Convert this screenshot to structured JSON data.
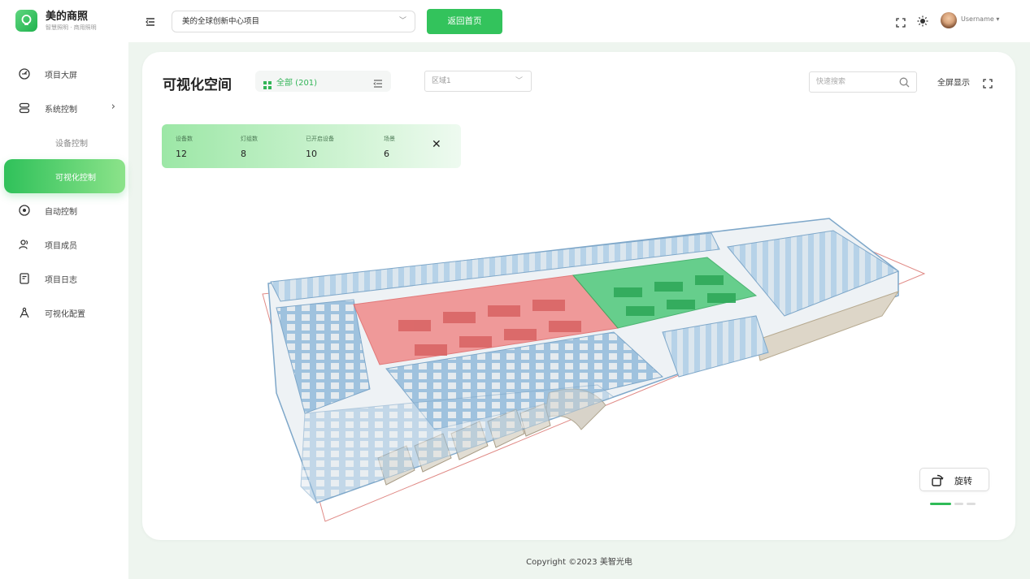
{
  "app": {
    "brand_name": "美的商照",
    "brand_sub": "智慧照明 · 商用照明"
  },
  "sidebar": {
    "items": [
      {
        "label": "项目大屏",
        "icon": "dashboard-icon"
      },
      {
        "label": "系统控制",
        "icon": "layers-icon",
        "expandable": true
      },
      {
        "label": "设备控制",
        "sub": true
      },
      {
        "label": "可视化控制",
        "sub": true,
        "active": true
      },
      {
        "label": "自动控制",
        "icon": "target-icon"
      },
      {
        "label": "项目成员",
        "icon": "users-icon"
      },
      {
        "label": "项目日志",
        "icon": "log-icon"
      },
      {
        "label": "可视化配置",
        "icon": "compass-icon"
      }
    ]
  },
  "topbar": {
    "project": "美的全球创新中心项目",
    "home_button": "返回首页",
    "username": "Username"
  },
  "main": {
    "title": "可视化空间",
    "filter_label": "全部 (201)",
    "region_placeholder": "区域1",
    "search_placeholder": "快速搜索",
    "fullscreen_label": "全屏显示",
    "rotate_label": "旋转"
  },
  "stats": [
    {
      "label": "设备数",
      "value": "12"
    },
    {
      "label": "灯组数",
      "value": "8"
    },
    {
      "label": "已开启设备",
      "value": "10"
    },
    {
      "label": "场景",
      "value": "6"
    }
  ],
  "pagination": {
    "total": 3,
    "active": 1
  },
  "footer": {
    "copyright": "Copyright ©2023 美智光电"
  },
  "colors": {
    "accent": "#33c35c",
    "zone_red": "#f08a8a",
    "zone_green": "#4fc87a",
    "walls": "#8fb7d8"
  }
}
